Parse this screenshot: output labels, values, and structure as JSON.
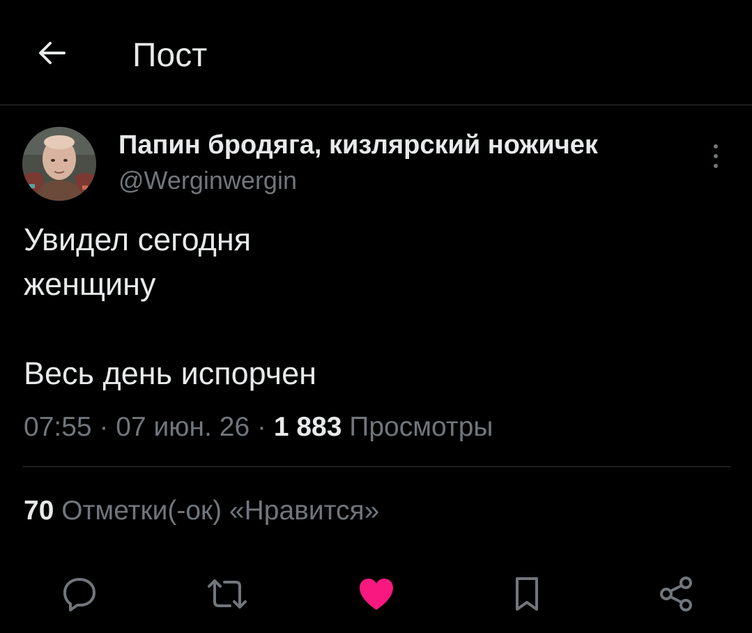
{
  "header": {
    "title": "Пост",
    "back_icon": "arrow-left-icon"
  },
  "post": {
    "author": {
      "display_name": "Папин бродяга, кизлярский ножичек",
      "handle": "@Werginwergin"
    },
    "text": "Увидел сегодня\nженщину\n\nВесь день испорчен",
    "time": "07:55",
    "date": "07 июн. 26",
    "separator": "·",
    "views_count": "1 883",
    "views_label": "Просмотры",
    "likes_count": "70",
    "likes_label": "Отметки(-ок) «Нравится»",
    "liked": true
  },
  "actions": [
    {
      "name": "reply",
      "icon": "reply-icon"
    },
    {
      "name": "repost",
      "icon": "repost-icon"
    },
    {
      "name": "like",
      "icon": "heart-icon",
      "active": true
    },
    {
      "name": "bookmark",
      "icon": "bookmark-icon"
    },
    {
      "name": "share",
      "icon": "share-icon"
    }
  ],
  "colors": {
    "background": "#000000",
    "text": "#e7e9ea",
    "muted": "#71767b",
    "divider": "#2f3336",
    "like_active": "#f91880"
  }
}
